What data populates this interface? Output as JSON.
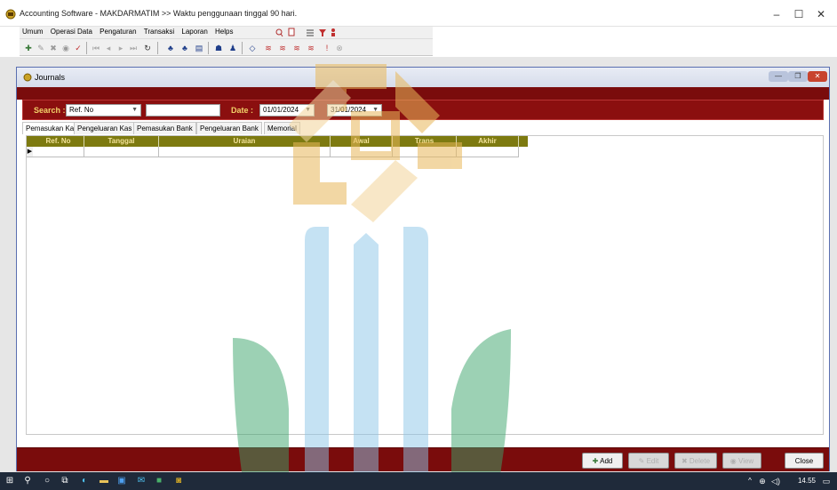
{
  "window": {
    "title": "Accounting Software - MAKDARMATIM >> Waktu penggunaan tinggal 90 hari.",
    "controls": {
      "minimize": "–",
      "maximize": "☐",
      "close": "✕"
    }
  },
  "menu": {
    "items": [
      "Umum",
      "Operasi Data",
      "Pengaturan",
      "Transaksi",
      "Laporan",
      "Helps"
    ]
  },
  "journals": {
    "title": "Journals",
    "search_label": "Search :",
    "search_field": "Ref. No",
    "search_value": "",
    "date_label": "Date :",
    "date_from": "01/01/2024",
    "date_to": "31/01/2024",
    "tabs": [
      "Pemasukan Kas",
      "Pengeluaran Kas",
      "Pemasukan Bank",
      "Pengeluaran Bank",
      "Memorial"
    ],
    "columns": [
      "Ref. No",
      "Tanggal",
      "Uraian",
      "Awal",
      "Trans",
      "Akhir"
    ],
    "buttons": {
      "add": "Add",
      "edit": "Edit",
      "delete": "Delete",
      "view": "View",
      "close": "Close"
    }
  },
  "taskbar": {
    "time": "14.55"
  },
  "colors": {
    "maroon": "#7a0c0c",
    "grid_header": "#7d7a10",
    "label_yellow": "#f2d36a"
  }
}
